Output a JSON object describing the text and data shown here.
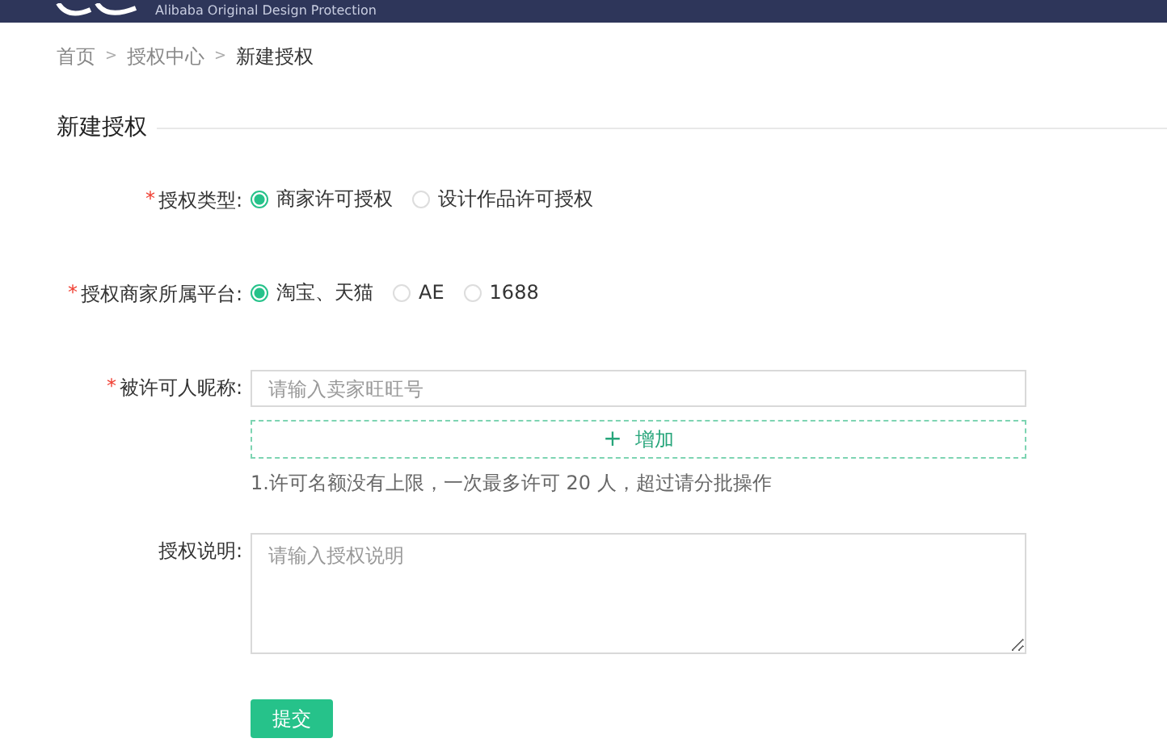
{
  "header": {
    "tagline": "Alibaba Original Design Protection"
  },
  "breadcrumb": {
    "items": [
      {
        "label": "首页",
        "current": false
      },
      {
        "label": "授权中心",
        "current": false
      },
      {
        "label": "新建授权",
        "current": true
      }
    ],
    "separator": ">"
  },
  "section_title": "新建授权",
  "form": {
    "fields": [
      {
        "kind": "radio",
        "mark": "*",
        "label": "授权类型:",
        "options": [
          {
            "label": "商家许可授权",
            "selected": true
          },
          {
            "label": "设计作品许可授权",
            "selected": false
          }
        ]
      },
      {
        "kind": "radio",
        "mark": "*",
        "label": "授权商家所属平台:",
        "options": [
          {
            "label": "淘宝、天猫",
            "selected": true
          },
          {
            "label": "AE",
            "selected": false
          },
          {
            "label": "1688",
            "selected": false
          }
        ]
      },
      {
        "kind": "input",
        "mark": "*",
        "label": "被许可人昵称:",
        "placeholder": "请输入卖家旺旺号",
        "add_button": {
          "icon": "+",
          "label": "增加"
        },
        "hint": "1.许可名额没有上限，一次最多许可 20 人，超过请分批操作"
      },
      {
        "kind": "textarea",
        "label": "授权说明:",
        "placeholder": "请输入授权说明"
      }
    ],
    "submit": "提交"
  }
}
